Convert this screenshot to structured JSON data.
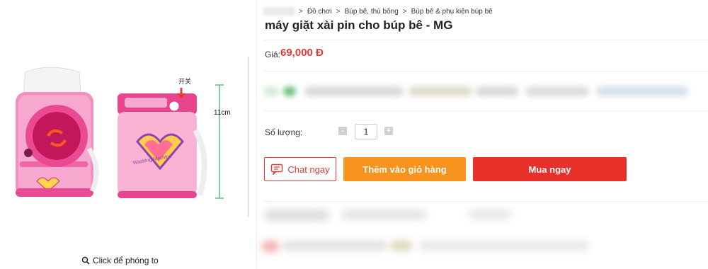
{
  "gallery": {
    "zoom_label": "Click để phóng to",
    "annotation_switch": "开关",
    "annotation_height": "11cm",
    "product_text": "Washing Machine"
  },
  "breadcrumb": {
    "items": [
      "Đồ chơi",
      "Búp bê, thú bông",
      "Búp bê & phụ kiện búp bê"
    ],
    "separator": ">"
  },
  "product": {
    "title": "máy giặt xài pin cho búp bê - MG",
    "price_label": "Giá:",
    "price": "69,000 Đ"
  },
  "quantity": {
    "label": "Số lượng:",
    "value": "1",
    "minus": "-",
    "plus": "+"
  },
  "actions": {
    "chat": "Chat ngay",
    "add_to_cart": "Thêm vào giỏ hàng",
    "buy_now": "Mua ngay"
  },
  "colors": {
    "price": "#e53935",
    "cart": "#f7931e",
    "buy": "#e8302a",
    "pink": "#f04c9a"
  }
}
